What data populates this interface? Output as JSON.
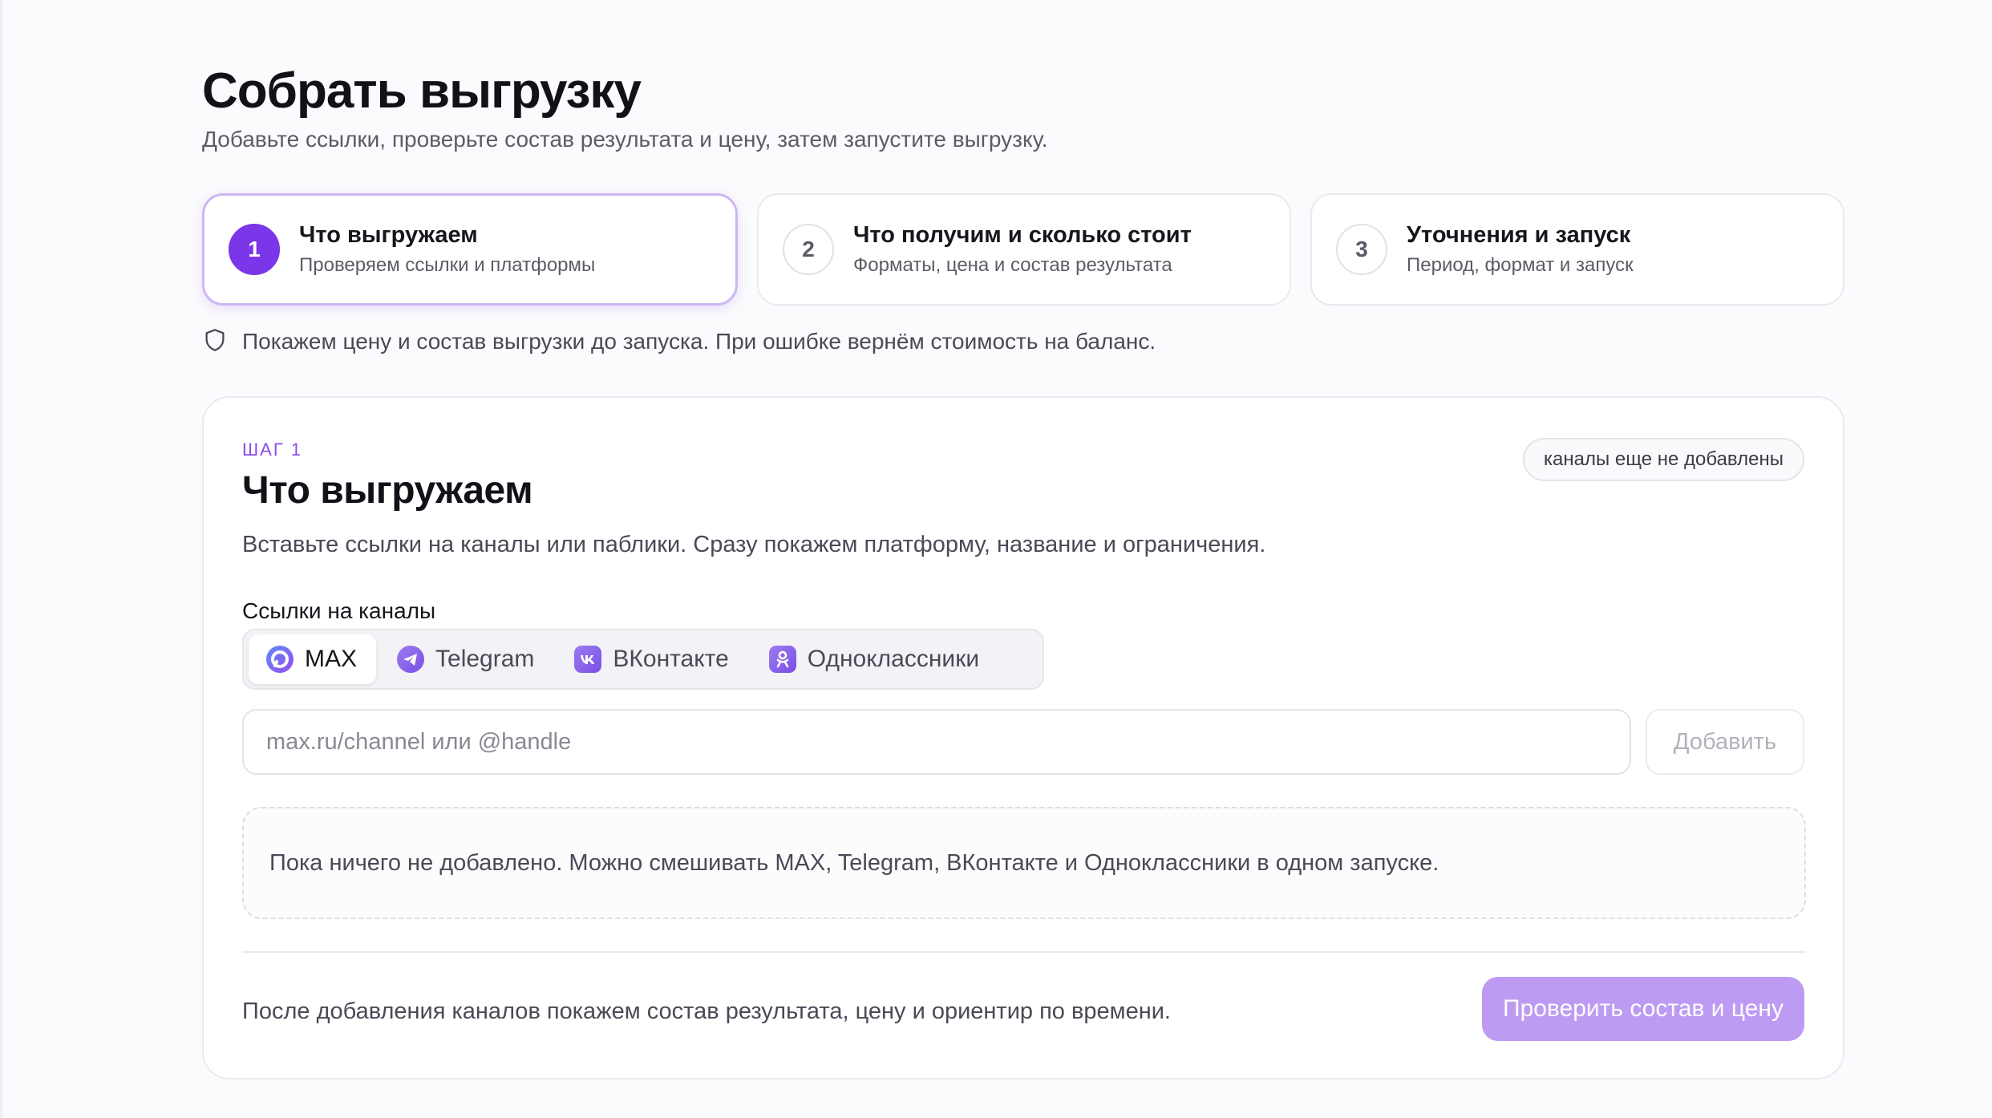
{
  "page": {
    "title": "Собрать выгрузку",
    "subtitle": "Добавьте ссылки, проверьте состав результата и цену, затем запустите выгрузку."
  },
  "steps": [
    {
      "number": "1",
      "title": "Что выгружаем",
      "subtitle": "Проверяем ссылки и платформы",
      "active": true
    },
    {
      "number": "2",
      "title": "Что получим и сколько стоит",
      "subtitle": "Форматы, цена и состав результата",
      "active": false
    },
    {
      "number": "3",
      "title": "Уточнения и запуск",
      "subtitle": "Период, формат и запуск",
      "active": false
    }
  ],
  "notice": {
    "icon": "shield-icon",
    "text": "Покажем цену и состав выгрузки до запуска. При ошибке вернём стоимость на баланс."
  },
  "card": {
    "eyebrow": "ШАГ 1",
    "title": "Что выгружаем",
    "description": "Вставьте ссылки на каналы или паблики. Сразу покажем платформу, название и ограничения.",
    "status_badge": "каналы еще не добавлены",
    "field_label": "Ссылки на каналы",
    "platform_tabs": [
      {
        "label": "MAX",
        "icon": "max-icon",
        "active": true
      },
      {
        "label": "Telegram",
        "icon": "telegram-icon",
        "active": false
      },
      {
        "label": "ВКонтакте",
        "icon": "vk-icon",
        "active": false
      },
      {
        "label": "Одноклассники",
        "icon": "ok-icon",
        "active": false
      }
    ],
    "input": {
      "value": "",
      "placeholder": "max.ru/channel или @handle"
    },
    "add_button": "Добавить",
    "empty_text": "Пока ничего не добавлено. Можно смешивать MAX, Telegram, ВКонтакте и Одноклассники в одном запуске.",
    "footer_hint": "После добавления каналов покажем состав результата, цену и ориентир по времени.",
    "primary_button": "Проверить состав и цену"
  },
  "colors": {
    "accent": "#7a36e8",
    "accent_disabled": "#bd9bf3",
    "eyebrow": "#8b4ce8"
  }
}
